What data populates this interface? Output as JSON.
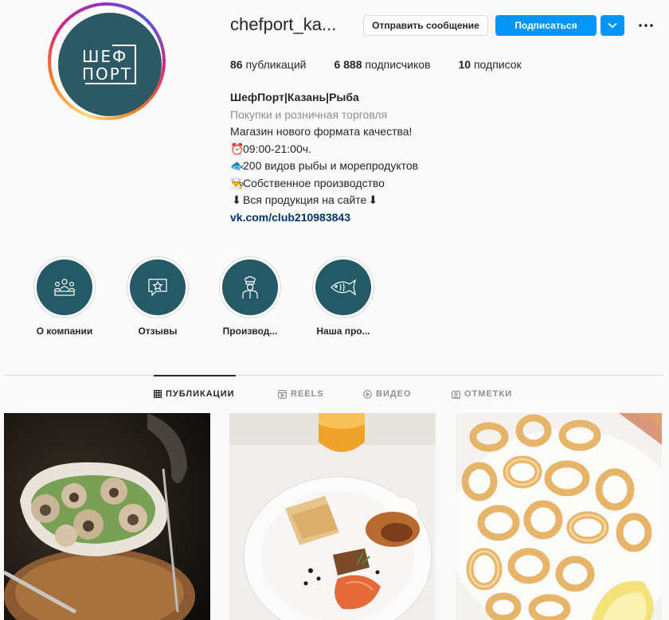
{
  "profile": {
    "avatar_logo": {
      "line1": "ШЕФ",
      "line2": "ПОРТ"
    },
    "username": "chefport_ka...",
    "message_button": "Отправить сообщение",
    "follow_button": "Подписаться",
    "stats": {
      "posts_count": "86",
      "posts_label": "публикаций",
      "followers_count": "6 888",
      "followers_label": "подписчиков",
      "following_count": "10",
      "following_label": "подписок"
    },
    "bio": {
      "name": "ШефПорт|Казань|Рыба",
      "category": "Покупки и розничная торговля",
      "line1": "Магазин нового формата качества!",
      "line2_emoji": "⏰",
      "line2": "09:00-21:00ч.",
      "line3_emoji": "🐟",
      "line3": "200 видов рыбы и морепродуктов",
      "line4_emoji": "👨‍🍳",
      "line4": "Собственное производство",
      "line5_emoji_start": "⬇",
      "line5": "Вся продукция на сайте",
      "line5_emoji_end": "⬇",
      "link": "vk.com/club210983843"
    }
  },
  "highlights": [
    {
      "label": "О компании",
      "icon": "company-icon"
    },
    {
      "label": "Отзывы",
      "icon": "reviews-icon"
    },
    {
      "label": "Производ...",
      "icon": "chef-icon"
    },
    {
      "label": "Наша про...",
      "icon": "fish-icon"
    }
  ],
  "tabs": [
    {
      "label": "ПУБЛИКАЦИИ",
      "icon": "grid-icon",
      "active": true
    },
    {
      "label": "REELS",
      "icon": "reels-icon",
      "active": false
    },
    {
      "label": "ВИДЕО",
      "icon": "video-icon",
      "active": false
    },
    {
      "label": "ОТМЕТКИ",
      "icon": "tagged-icon",
      "active": false
    }
  ],
  "colors": {
    "brand_teal": "#2c5963",
    "follow_blue": "#0095f6",
    "link": "#00376b"
  }
}
